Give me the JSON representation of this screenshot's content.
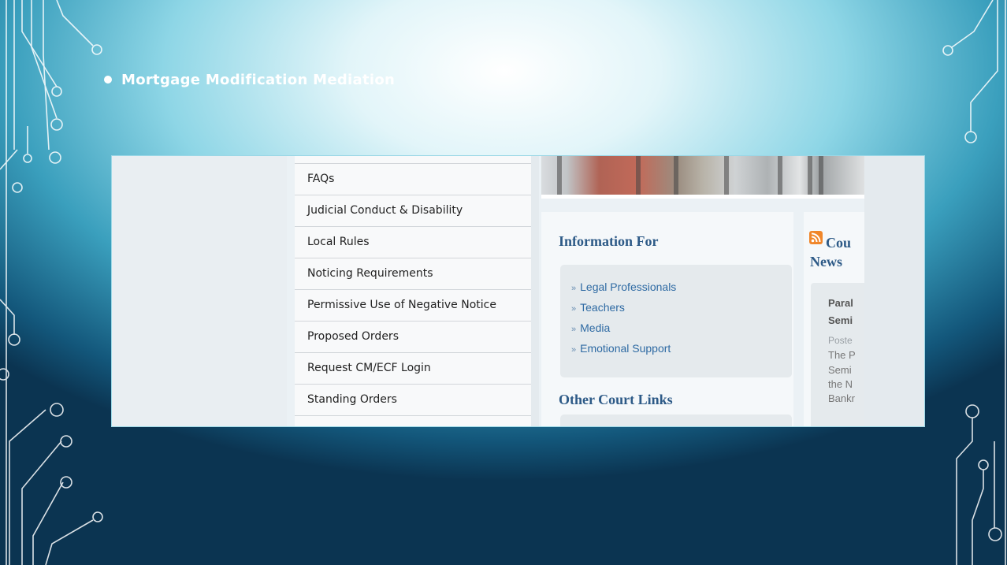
{
  "slide": {
    "title": "Mortgage Modification Mediation"
  },
  "sidebar": {
    "items": [
      "FAQs",
      "Judicial Conduct & Disability",
      "Local Rules",
      "Noticing Requirements",
      "Permissive Use of Negative Notice",
      "Proposed Orders",
      "Request CM/ECF Login",
      "Standing Orders"
    ]
  },
  "info_for": {
    "heading": "Information For",
    "links": [
      "Legal Professionals",
      "Teachers",
      "Media",
      "Emotional Support"
    ]
  },
  "other_links": {
    "heading": "Other Court Links"
  },
  "news": {
    "title_line1": "Cou",
    "title_line2": "News",
    "headline_line1": "Paral",
    "headline_line2": "Semi",
    "posted": "Poste",
    "body_lines": [
      "The P",
      "Semi",
      "the N",
      "Bankr"
    ]
  },
  "colors": {
    "heading_blue": "#2d5a87",
    "link_blue": "#2e6aa3",
    "rss_orange": "#f0862a",
    "circuit_white": "#ffffff"
  },
  "icons": {
    "rss": "rss-icon",
    "bullet": "bullet-dot"
  }
}
